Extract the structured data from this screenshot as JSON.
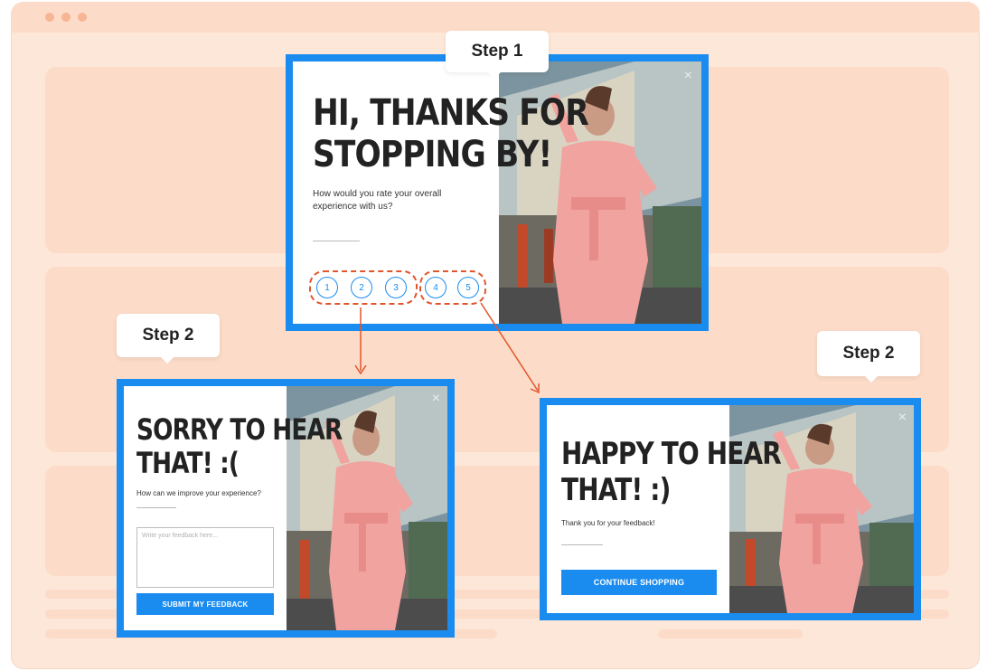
{
  "colors": {
    "accent": "#1a8cf0",
    "page_bg": "#fde7d8",
    "annotation": "#e0562c"
  },
  "icons": {
    "close": "close-icon",
    "arrow": "arrow-icon"
  },
  "close_glyph": "×",
  "step1": {
    "tag": "Step 1",
    "headline_line1": "HI, THANKS FOR",
    "headline_line2": "STOPPING BY!",
    "question_line1": "How would you rate your overall",
    "question_line2": "experience with us?",
    "ratings": [
      "1",
      "2",
      "3",
      "4",
      "5"
    ]
  },
  "step2_sorry": {
    "tag": "Step 2",
    "headline_line1": "SORRY TO HEAR",
    "headline_line2": "THAT! :(",
    "question": "How can we improve your experience?",
    "feedback_placeholder": "Write your feedback here...",
    "submit_label": "SUBMIT MY FEEDBACK"
  },
  "step2_happy": {
    "tag": "Step 2",
    "headline_line1": "HAPPY TO HEAR",
    "headline_line2": "THAT! :)",
    "message": "Thank you for your feedback!",
    "continue_label": "CONTINUE SHOPPING"
  }
}
